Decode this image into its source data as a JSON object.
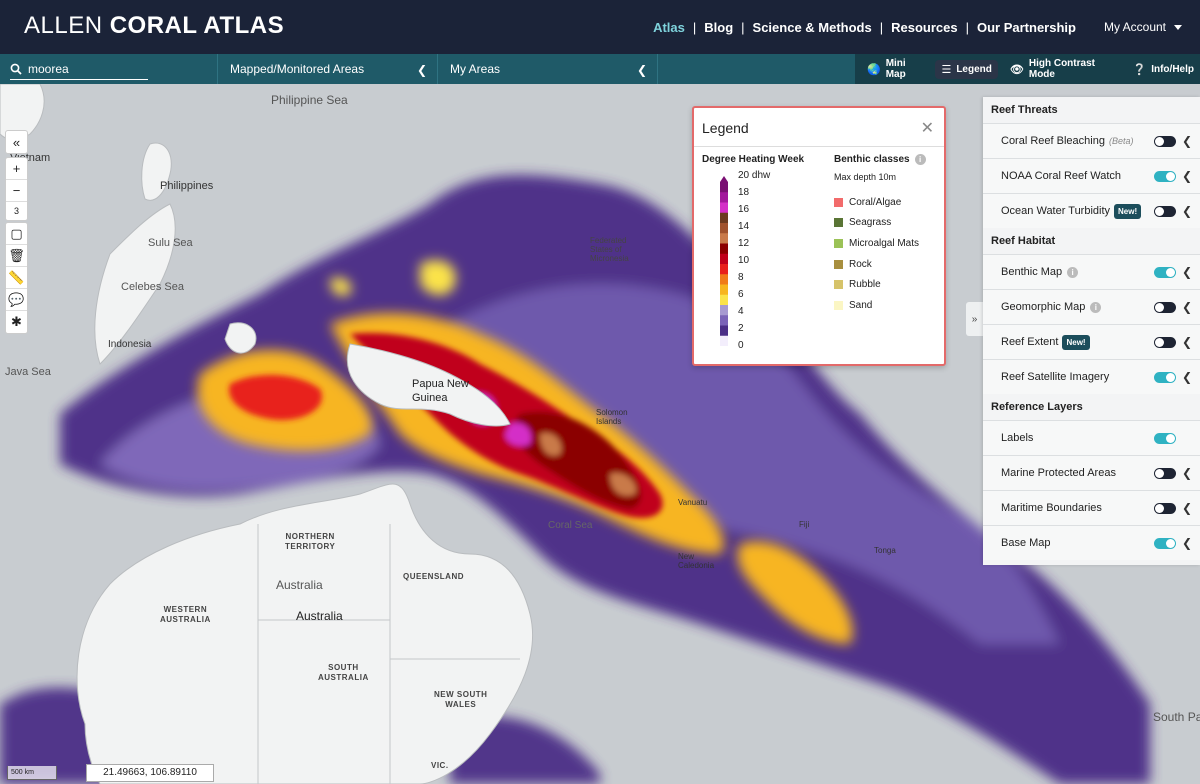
{
  "brand": {
    "light": "ALLEN",
    "bold": "CORAL ATLAS"
  },
  "nav": {
    "items": [
      "Atlas",
      "Blog",
      "Science & Methods",
      "Resources",
      "Our Partnership"
    ],
    "account": "My Account"
  },
  "subbar": {
    "search_value": "moorea",
    "mapped_label": "Mapped/Monitored Areas",
    "my_areas_label": "My Areas",
    "tools": [
      "Mini Map",
      "Legend",
      "High Contrast Mode",
      "Info/Help"
    ]
  },
  "map_controls": {
    "zoom_level": "3"
  },
  "map_labels": {
    "philippine_sea": "Philippine Sea",
    "vietnam": "Vietnam",
    "philippines": "Philippines",
    "sulu_sea": "Sulu Sea",
    "celebes_sea": "Celebes Sea",
    "java_sea": "Java Sea",
    "indonesia": "Indonesia",
    "papua": "Papua New\nGuinea",
    "fsm": "Federated\nStates of\nMicronesia",
    "coral_sea": "Coral Sea",
    "vanuatu": "Vanuatu",
    "new_caledonia": "New\nCaledonia",
    "fiji": "Fiji",
    "tonga": "Tonga",
    "northern_territory": "NORTHERN\nTERRITORY",
    "queensland": "QUEENSLAND",
    "western_australia": "WESTERN\nAUSTRALIA",
    "south_australia": "SOUTH\nAUSTRALIA",
    "new_south_wales": "NEW SOUTH\nWALES",
    "vic": "VIC.",
    "australia1": "Australia",
    "australia2": "Australia",
    "south_pacific": "South Pa",
    "solomon": "Solomon\nIslands"
  },
  "legend": {
    "title": "Legend",
    "dhw_title": "Degree Heating Week",
    "dhw_labels": [
      "20 dhw",
      "18",
      "16",
      "14",
      "12",
      "10",
      "8",
      "6",
      "4",
      "2",
      "0"
    ],
    "dhw_colors": [
      "#7a0f73",
      "#a3179c",
      "#d42fc7",
      "#6b3a1f",
      "#a0522d",
      "#c97a4a",
      "#8b0000",
      "#c0001a",
      "#e8201c",
      "#f07b1a",
      "#f7b520",
      "#fbe34a",
      "#a79ad1",
      "#7b64b8",
      "#4b2f87",
      "#f3eefc"
    ],
    "benthic_title": "Benthic classes",
    "benthic_sub": "Max depth 10m",
    "benthic": [
      {
        "label": "Coral/Algae",
        "color": "#f26b6b"
      },
      {
        "label": "Seagrass",
        "color": "#5a7535"
      },
      {
        "label": "Microalgal Mats",
        "color": "#9bc257"
      },
      {
        "label": "Rock",
        "color": "#a88f3f"
      },
      {
        "label": "Rubble",
        "color": "#d6c36a"
      },
      {
        "label": "Sand",
        "color": "#fbf6c4"
      }
    ]
  },
  "panel": {
    "sections": [
      {
        "title": "Reef Threats",
        "rows": [
          {
            "label": "Coral Reef Bleaching",
            "beta": "(Beta)",
            "on": false
          },
          {
            "label": "NOAA Coral Reef Watch",
            "on": true
          },
          {
            "label": "Ocean Water Turbidity",
            "badge": "New!",
            "on": false
          }
        ]
      },
      {
        "title": "Reef Habitat",
        "rows": [
          {
            "label": "Benthic Map",
            "info": true,
            "on": true
          },
          {
            "label": "Geomorphic Map",
            "info": true,
            "on": false
          },
          {
            "label": "Reef Extent",
            "badge": "New!",
            "on": false
          },
          {
            "label": "Reef Satellite Imagery",
            "on": true
          }
        ]
      },
      {
        "title": "Reference Layers",
        "rows": [
          {
            "label": "Labels",
            "on": true,
            "nocaret": true
          },
          {
            "label": "Marine Protected Areas",
            "on": false
          },
          {
            "label": "Maritime Boundaries",
            "on": false
          },
          {
            "label": "Base Map",
            "on": true
          }
        ]
      }
    ]
  },
  "footer": {
    "scale": "500 km",
    "coords": "21.49663, 106.89110"
  }
}
